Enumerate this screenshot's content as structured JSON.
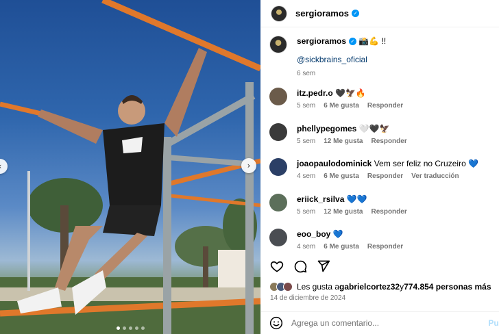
{
  "header": {
    "username": "sergioramos"
  },
  "caption": {
    "username": "sergioramos",
    "text": "📸💪 !!",
    "mention": "@sickbrains_oficial",
    "time": "6 sem"
  },
  "comments": [
    {
      "user": "itz.pedr.o",
      "text": "🖤🦅🔥",
      "time": "5 sem",
      "likes": "6 Me gusta",
      "reply": "Responder",
      "translate": "",
      "avatar_color": "#6b5b4a"
    },
    {
      "user": "phellypegomes",
      "text": "🤍🖤🦅",
      "time": "5 sem",
      "likes": "12 Me gusta",
      "reply": "Responder",
      "translate": "",
      "avatar_color": "#3a3a3a"
    },
    {
      "user": "joaopaulodominick",
      "text": "Vem ser feliz no Cruzeiro 💙",
      "time": "4 sem",
      "likes": "6 Me gusta",
      "reply": "Responder",
      "translate": "Ver traducción",
      "avatar_color": "#2b3f66"
    },
    {
      "user": "eriick_rsilva",
      "text": "💙💙",
      "time": "5 sem",
      "likes": "12 Me gusta",
      "reply": "Responder",
      "translate": "",
      "avatar_color": "#5c6f5a"
    },
    {
      "user": "eoo_boy",
      "text": "💙",
      "time": "4 sem",
      "likes": "6 Me gusta",
      "reply": "Responder",
      "translate": "",
      "avatar_color": "#4a4d52"
    }
  ],
  "likes": {
    "prefix": "Les gusta a ",
    "user": "gabrielcortez32",
    "middle": " y ",
    "count": "774.854 personas más"
  },
  "date": "14 de diciembre de 2024",
  "add_comment": {
    "placeholder": "Agrega un comentario...",
    "publish": "Pub"
  },
  "icons": [
    "heart-icon",
    "comment-icon",
    "share-icon",
    "emoji-icon",
    "verified-icon"
  ],
  "colors": {
    "link": "#00376b",
    "verified": "#0095f6",
    "muted": "#737373"
  }
}
